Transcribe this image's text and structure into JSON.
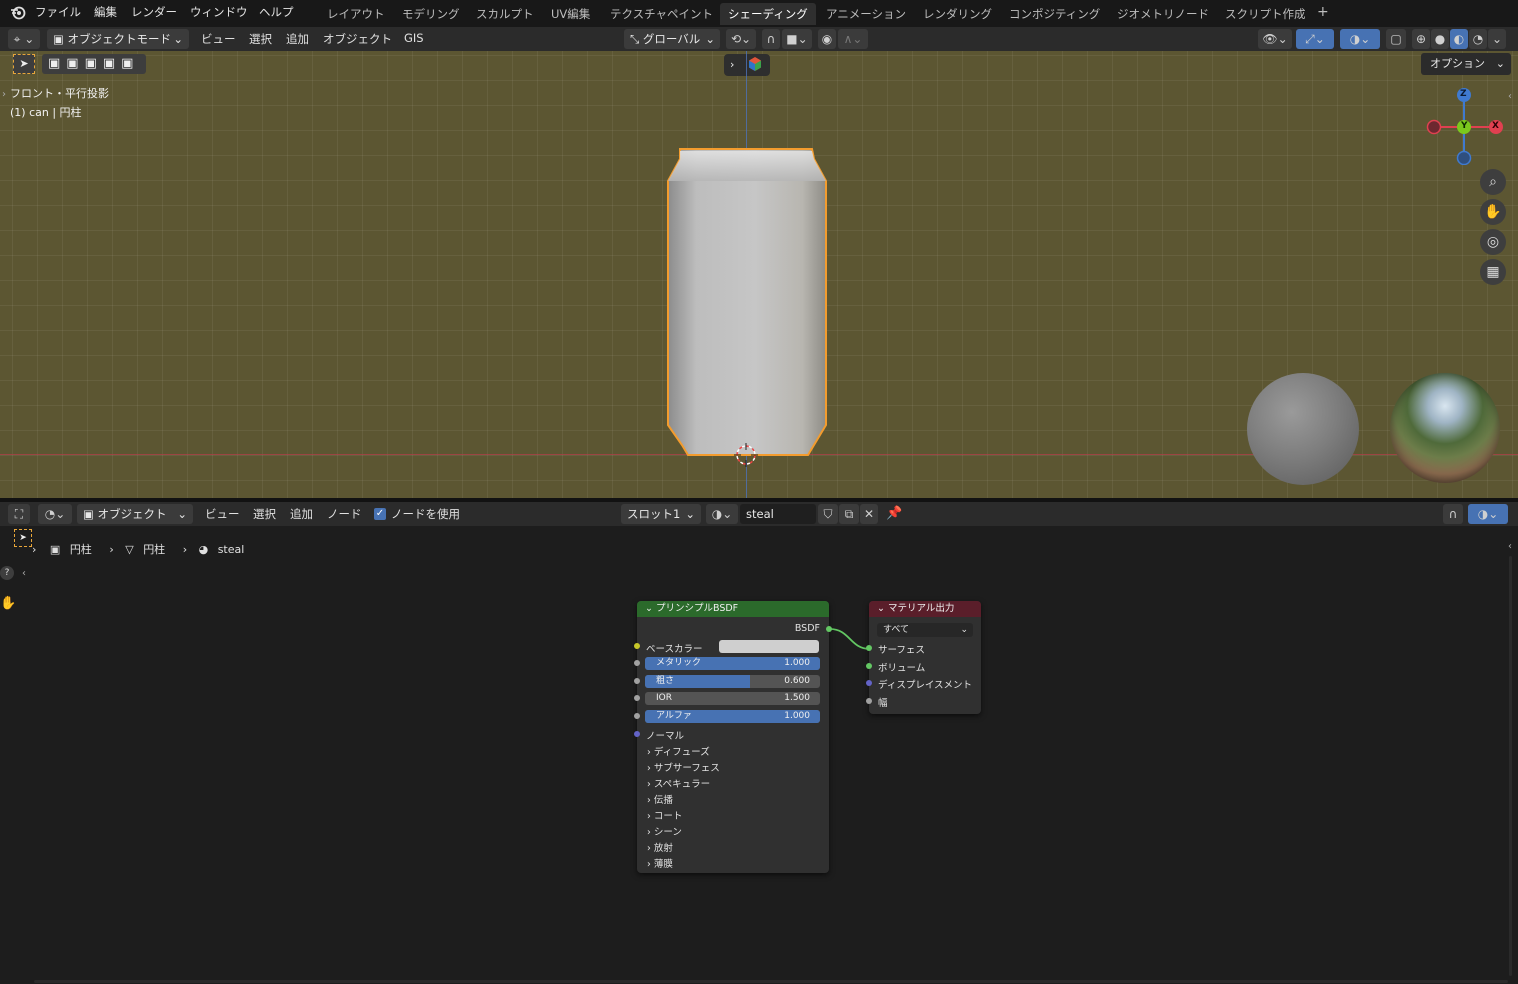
{
  "menu": [
    "ファイル",
    "編集",
    "レンダー",
    "ウィンドウ",
    "ヘルプ"
  ],
  "workspaces": [
    "レイアウト",
    "モデリング",
    "スカルプト",
    "UV編集",
    "テクスチャペイント",
    "シェーディング",
    "アニメーション",
    "レンダリング",
    "コンポジティング",
    "ジオメトリノード",
    "スクリプト作成"
  ],
  "workspace_add": "+",
  "viewport_header": {
    "mode": "オブジェクトモード",
    "items": [
      "ビュー",
      "選択",
      "追加",
      "オブジェクト",
      "GIS"
    ],
    "orientation": "グローバル",
    "options": "オプション"
  },
  "viewport_overlay": {
    "view_name": "フロント・平行投影",
    "object_info": "(1) can | 円柱"
  },
  "gizmo": {
    "z": "Z",
    "y": "Y",
    "x": "X"
  },
  "node_header": {
    "mode": "オブジェクト",
    "items": [
      "ビュー",
      "選択",
      "追加",
      "ノード"
    ],
    "use_nodes": "ノードを使用",
    "slot": "スロット1",
    "material": "steal"
  },
  "breadcrumb": [
    "円柱",
    "円柱",
    "steal"
  ],
  "bsdf_node": {
    "title": "プリンシプルBSDF",
    "output": "BSDF",
    "base_color": "ベースカラー",
    "fields": [
      {
        "label": "メタリック",
        "value": "1.000",
        "fraction": 1.0
      },
      {
        "label": "粗さ",
        "value": "0.600",
        "fraction": 0.6
      },
      {
        "label": "IOR",
        "value": "1.500",
        "fraction": 0.0
      },
      {
        "label": "アルファ",
        "value": "1.000",
        "fraction": 1.0
      }
    ],
    "normal": "ノーマル",
    "panels": [
      "ディフューズ",
      "サブサーフェス",
      "スペキュラー",
      "伝播",
      "コート",
      "シーン",
      "放射",
      "薄膜"
    ]
  },
  "output_node": {
    "title": "マテリアル出力",
    "target": "すべて",
    "inputs": [
      "サーフェス",
      "ボリューム",
      "ディスプレイスメント",
      "幅"
    ]
  },
  "colors": {
    "viewport_bg": "#5c5632",
    "bsdf_header": "#2b6a2b",
    "output_header": "#5a1e2a",
    "selection_outline": "#f39c2e",
    "accent": "#4772b3"
  }
}
